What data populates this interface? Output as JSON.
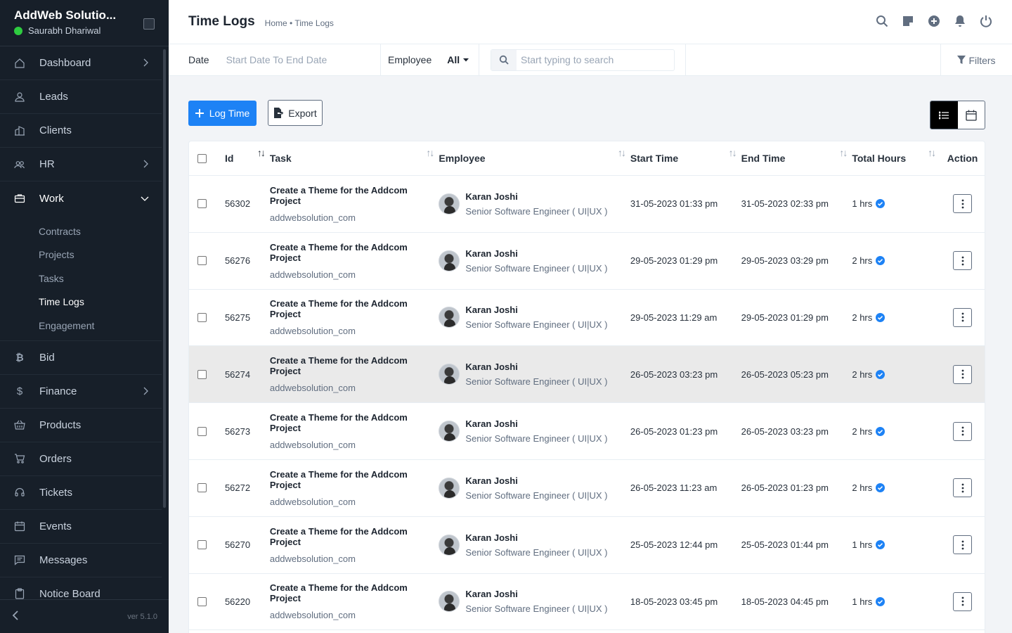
{
  "app": {
    "brand": "AddWeb Solutio...",
    "user": "Saurabh Dhariwal",
    "version": "ver 5.1.0"
  },
  "sidebar": {
    "items": [
      {
        "label": "Dashboard",
        "icon": "house-icon",
        "chevron": "right"
      },
      {
        "label": "Leads",
        "icon": "person-icon"
      },
      {
        "label": "Clients",
        "icon": "building-icon"
      },
      {
        "label": "HR",
        "icon": "people-icon",
        "chevron": "right"
      },
      {
        "label": "Work",
        "icon": "briefcase-icon",
        "chevron": "down"
      },
      {
        "label": "Bid",
        "icon": "bitcoin-icon"
      },
      {
        "label": "Finance",
        "icon": "dollar-icon",
        "chevron": "right"
      },
      {
        "label": "Products",
        "icon": "basket-icon"
      },
      {
        "label": "Orders",
        "icon": "cart-icon"
      },
      {
        "label": "Tickets",
        "icon": "headset-icon"
      },
      {
        "label": "Events",
        "icon": "calendar-icon"
      },
      {
        "label": "Messages",
        "icon": "chat-icon"
      },
      {
        "label": "Notice Board",
        "icon": "clipboard-icon"
      }
    ],
    "work_sub": [
      "Contracts",
      "Projects",
      "Tasks",
      "Time Logs",
      "Engagement"
    ]
  },
  "header": {
    "title": "Time Logs",
    "breadcrumb": "Home • Time Logs"
  },
  "filters": {
    "date_label": "Date",
    "date_placeholder": "Start Date To End Date",
    "employee_label": "Employee",
    "employee_value": "All",
    "search_placeholder": "Start typing to search",
    "filters_label": "Filters"
  },
  "actions": {
    "log_time": "Log Time",
    "export": "Export"
  },
  "table": {
    "columns": [
      "Id",
      "Task",
      "Employee",
      "Start Time",
      "End Time",
      "Total Hours",
      "Action"
    ],
    "rows": [
      {
        "id": "56302",
        "task": "Create a Theme for the Addcom Project",
        "project": "addwebsolution_com",
        "employee": "Karan Joshi",
        "role": "Senior Software Engineer ( UI|UX )",
        "start": "31-05-2023 01:33 pm",
        "end": "31-05-2023 02:33 pm",
        "hours": "1 hrs"
      },
      {
        "id": "56276",
        "task": "Create a Theme for the Addcom Project",
        "project": "addwebsolution_com",
        "employee": "Karan Joshi",
        "role": "Senior Software Engineer ( UI|UX )",
        "start": "29-05-2023 01:29 pm",
        "end": "29-05-2023 03:29 pm",
        "hours": "2 hrs"
      },
      {
        "id": "56275",
        "task": "Create a Theme for the Addcom Project",
        "project": "addwebsolution_com",
        "employee": "Karan Joshi",
        "role": "Senior Software Engineer ( UI|UX )",
        "start": "29-05-2023 11:29 am",
        "end": "29-05-2023 01:29 pm",
        "hours": "2 hrs"
      },
      {
        "id": "56274",
        "task": "Create a Theme for the Addcom Project",
        "project": "addwebsolution_com",
        "employee": "Karan Joshi",
        "role": "Senior Software Engineer ( UI|UX )",
        "start": "26-05-2023 03:23 pm",
        "end": "26-05-2023 05:23 pm",
        "hours": "2 hrs"
      },
      {
        "id": "56273",
        "task": "Create a Theme for the Addcom Project",
        "project": "addwebsolution_com",
        "employee": "Karan Joshi",
        "role": "Senior Software Engineer ( UI|UX )",
        "start": "26-05-2023 01:23 pm",
        "end": "26-05-2023 03:23 pm",
        "hours": "2 hrs"
      },
      {
        "id": "56272",
        "task": "Create a Theme for the Addcom Project",
        "project": "addwebsolution_com",
        "employee": "Karan Joshi",
        "role": "Senior Software Engineer ( UI|UX )",
        "start": "26-05-2023 11:23 am",
        "end": "26-05-2023 01:23 pm",
        "hours": "2 hrs"
      },
      {
        "id": "56270",
        "task": "Create a Theme for the Addcom Project",
        "project": "addwebsolution_com",
        "employee": "Karan Joshi",
        "role": "Senior Software Engineer ( UI|UX )",
        "start": "25-05-2023 12:44 pm",
        "end": "25-05-2023 01:44 pm",
        "hours": "1 hrs"
      },
      {
        "id": "56220",
        "task": "Create a Theme for the Addcom Project",
        "project": "addwebsolution_com",
        "employee": "Karan Joshi",
        "role": "Senior Software Engineer ( UI|UX )",
        "start": "18-05-2023 03:45 pm",
        "end": "18-05-2023 04:45 pm",
        "hours": "1 hrs"
      }
    ]
  },
  "colors": {
    "sidebar_bg": "#171f29",
    "primary": "#1d82f5",
    "online": "#2ecc40"
  }
}
